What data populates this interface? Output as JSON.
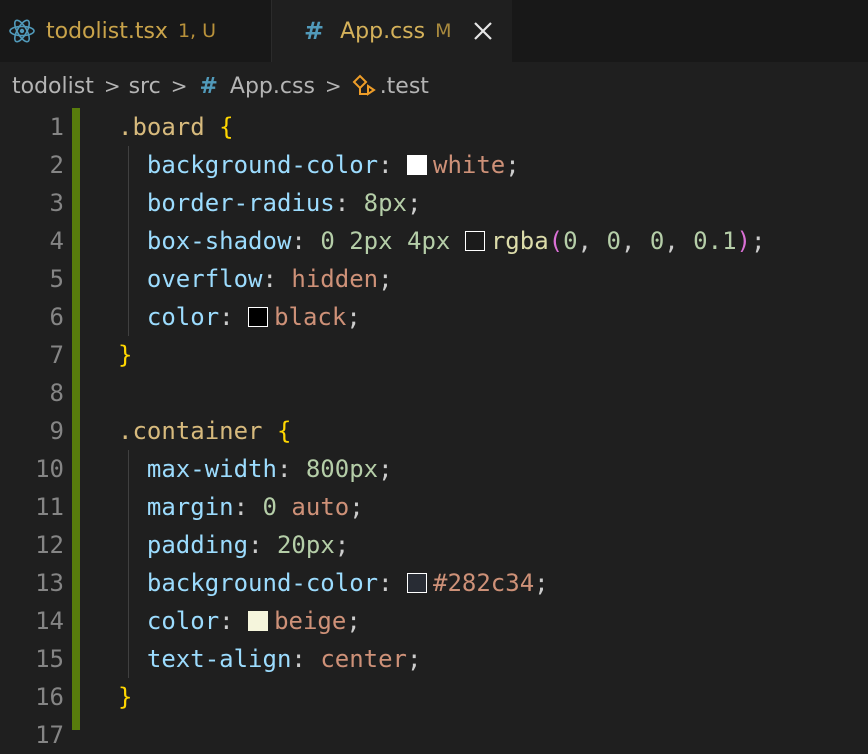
{
  "tabs": [
    {
      "name": "todolist.tsx",
      "badge": "1, U",
      "active": false
    },
    {
      "name": "App.css",
      "badge": "M",
      "active": true
    }
  ],
  "breadcrumb": {
    "folder1": "todolist",
    "folder2": "src",
    "file": "App.css",
    "symbol": ".test",
    "separator": ">"
  },
  "icons": {
    "hash": "#",
    "close": "close-icon",
    "react": "react-icon",
    "symbol": "symbol-class-icon"
  },
  "colors": {
    "modified_bar": "#587c0c",
    "hash_blue": "#519aba",
    "tab_text": "#c9a34a"
  },
  "line_numbers": [
    "1",
    "2",
    "3",
    "4",
    "5",
    "6",
    "7",
    "8",
    "9",
    "10",
    "11",
    "12",
    "13",
    "14",
    "15",
    "16",
    "17"
  ],
  "code": {
    "l1": {
      "selector": ".board",
      "brace": "{"
    },
    "l2": {
      "prop": "background-color",
      "colon": ":",
      "value": "white",
      "semi": ";",
      "swatch": "#ffffff"
    },
    "l3": {
      "prop": "border-radius",
      "colon": ":",
      "value": "8px",
      "semi": ";"
    },
    "l4": {
      "prop": "box-shadow",
      "colon": ":",
      "v1": "0",
      "v2": "2px",
      "v3": "4px",
      "fn": "rgba",
      "open": "(",
      "a1": "0",
      "a2": "0",
      "a3": "0",
      "a4": "0.1",
      "close": ")",
      "semi": ";",
      "swatch": "rgba(0,0,0,0.1)"
    },
    "l5": {
      "prop": "overflow",
      "colon": ":",
      "value": "hidden",
      "semi": ";"
    },
    "l6": {
      "prop": "color",
      "colon": ":",
      "value": "black",
      "semi": ";",
      "swatch": "#000000"
    },
    "l7": {
      "brace": "}"
    },
    "l9": {
      "selector": ".container",
      "brace": "{"
    },
    "l10": {
      "prop": "max-width",
      "colon": ":",
      "value": "800px",
      "semi": ";"
    },
    "l11": {
      "prop": "margin",
      "colon": ":",
      "v1": "0",
      "v2": "auto",
      "semi": ";"
    },
    "l12": {
      "prop": "padding",
      "colon": ":",
      "value": "20px",
      "semi": ";"
    },
    "l13": {
      "prop": "background-color",
      "colon": ":",
      "value": "#282c34",
      "semi": ";",
      "swatch": "#282c34"
    },
    "l14": {
      "prop": "color",
      "colon": ":",
      "value": "beige",
      "semi": ";",
      "swatch": "#f5f5dc"
    },
    "l15": {
      "prop": "text-align",
      "colon": ":",
      "value": "center",
      "semi": ";"
    },
    "l16": {
      "brace": "}"
    }
  }
}
